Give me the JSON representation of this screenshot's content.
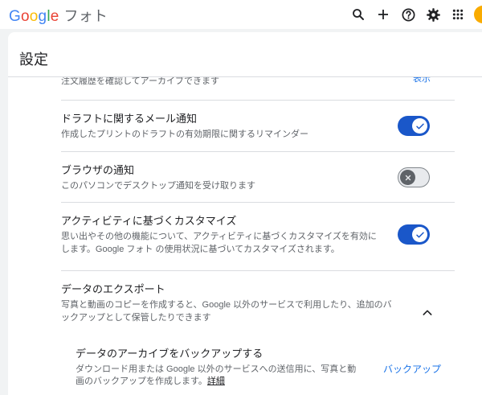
{
  "app": {
    "logo_text": "Google",
    "logo_letters": [
      "G",
      "o",
      "o",
      "g",
      "l",
      "e"
    ],
    "app_name": "フォト"
  },
  "header_icons": [
    "search-icon",
    "add-icon",
    "help-icon",
    "settings-icon",
    "apps-grid-icon",
    "account-avatar"
  ],
  "settings": {
    "title": "設定",
    "partial_row": {
      "description": "注文履歴を確認してアーカイブできます",
      "link": "表示"
    },
    "rows": [
      {
        "title": "ドラフトに関するメール通知",
        "description": "作成したプリントのドラフトの有効期限に関するリマインダー",
        "toggle": "on"
      },
      {
        "title": "ブラウザの通知",
        "description": "このパソコンでデスクトップ通知を受け取ります",
        "toggle": "off"
      },
      {
        "title": "アクティビティに基づくカスタマイズ",
        "description": "思い出やその他の機能について、アクティビティに基づくカスタマイズを有効にします。Google フォト の使用状況に基づいてカスタマイズされます。",
        "toggle": "on"
      }
    ],
    "export": {
      "title": "データのエクスポート",
      "description": "写真と動画のコピーを作成すると、Google 以外のサービスで利用したり、追加のバックアップとして保管したりできます",
      "expanded": true,
      "sub": {
        "title": "データのアーカイブをバックアップする",
        "description": "ダウンロード用または Google 以外のサービスへの送信用に、写真と動画のバックアップを作成します。",
        "details_link": "詳細",
        "action": "バックアップ"
      }
    }
  },
  "colors": {
    "accent": "#1a73e8",
    "toggle_on": "#1a57c9",
    "background": "#f1f3f4"
  }
}
